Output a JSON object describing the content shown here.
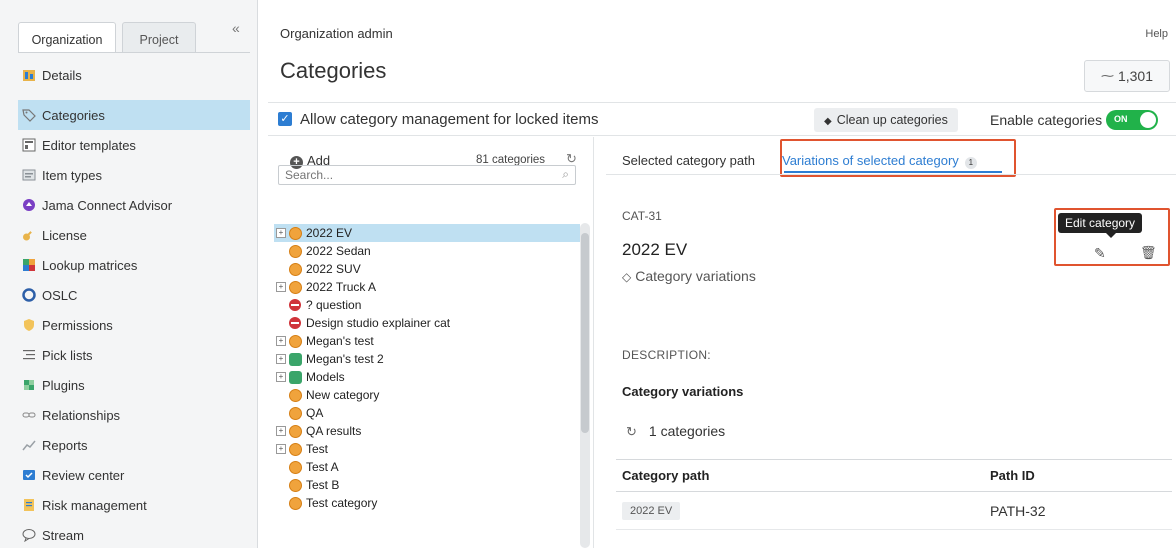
{
  "sidebar": {
    "tabs": [
      "Organization",
      "Project"
    ],
    "collapse_glyph": "«",
    "items": [
      {
        "label": "Details",
        "icon": "details-icon"
      },
      {
        "label": "Categories",
        "icon": "tag-icon"
      },
      {
        "label": "Editor templates",
        "icon": "template-icon"
      },
      {
        "label": "Item types",
        "icon": "item-types-icon"
      },
      {
        "label": "Jama Connect Advisor",
        "icon": "advisor-icon"
      },
      {
        "label": "License",
        "icon": "key-icon"
      },
      {
        "label": "Lookup matrices",
        "icon": "grid-icon"
      },
      {
        "label": "OSLC",
        "icon": "oslc-icon"
      },
      {
        "label": "Permissions",
        "icon": "shield-icon"
      },
      {
        "label": "Pick lists",
        "icon": "list-icon"
      },
      {
        "label": "Plugins",
        "icon": "plugin-icon"
      },
      {
        "label": "Relationships",
        "icon": "link-icon"
      },
      {
        "label": "Reports",
        "icon": "chart-icon"
      },
      {
        "label": "Review center",
        "icon": "review-icon"
      },
      {
        "label": "Risk management",
        "icon": "risk-icon"
      },
      {
        "label": "Stream",
        "icon": "chat-icon"
      }
    ]
  },
  "header": {
    "breadcrumb": "Organization admin",
    "help": "Help",
    "title": "Categories",
    "activity_count": "1,301"
  },
  "toolbar": {
    "lock_label": "Allow category management for locked items",
    "cleanup_label": "Clean up categories",
    "enable_label": "Enable categories",
    "toggle_state": "ON"
  },
  "tree": {
    "add_label": "Add",
    "count_label": "81 categories",
    "search_placeholder": "Search...",
    "items": [
      {
        "label": "2022 EV"
      },
      {
        "label": "2022 Sedan"
      },
      {
        "label": "2022 SUV"
      },
      {
        "label": "2022 Truck A"
      },
      {
        "label": "? question"
      },
      {
        "label": "Design studio explainer cat"
      },
      {
        "label": "Megan's test"
      },
      {
        "label": "Megan's test 2"
      },
      {
        "label": "Models"
      },
      {
        "label": "New category"
      },
      {
        "label": "QA"
      },
      {
        "label": "QA results"
      },
      {
        "label": "Test"
      },
      {
        "label": "Test A"
      },
      {
        "label": "Test B"
      },
      {
        "label": "Test category"
      }
    ]
  },
  "detail": {
    "tab_path": "Selected category path",
    "tab_variations": "Variations of selected category",
    "variations_badge": "1",
    "category_id": "CAT-31",
    "category_name": "2022 EV",
    "category_subtitle": "Category variations",
    "edit_tooltip": "Edit category",
    "description_label": "DESCRIPTION:",
    "variations_heading": "Category variations",
    "variations_count": "1 categories",
    "table": {
      "headers": [
        "Category path",
        "Path ID"
      ],
      "rows": [
        {
          "path": "2022 EV",
          "path_id": "PATH-32"
        }
      ]
    }
  },
  "colors": {
    "accent": "#2d7dd2",
    "selected_bg": "#bfe0f2",
    "toggle_on": "#21b24a",
    "highlight_border": "#e0542f"
  }
}
